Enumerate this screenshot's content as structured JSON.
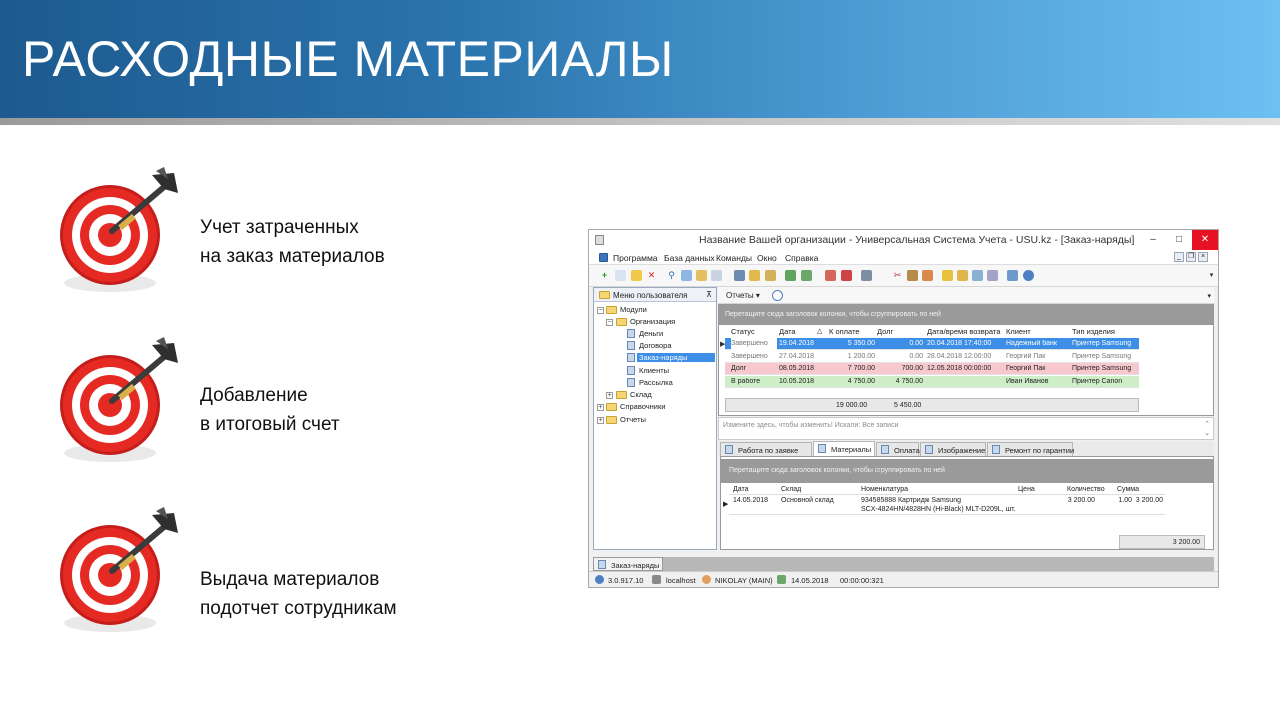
{
  "slide": {
    "title": "РАСХОДНЫЕ МАТЕРИАЛЫ"
  },
  "bullets": [
    {
      "icon": "dart-target-icon",
      "line1": "Учет затраченных",
      "line2": "на заказ материалов"
    },
    {
      "icon": "dart-target-icon",
      "line1": "Добавление",
      "line2": "в итоговый счет"
    },
    {
      "icon": "dart-target-icon",
      "line1": "Выдача материалов",
      "line2": "подотчет сотрудникам"
    }
  ],
  "window": {
    "title": "Название Вашей организации - Универсальная Система Учета - USU.kz - [Заказ-наряды]",
    "controls": {
      "minimize": "–",
      "maximize": "□",
      "close": "✕"
    },
    "mdi_controls": {
      "minimize": "_",
      "restore": "❐",
      "close": "×"
    },
    "menu": [
      "Программа",
      "База данных",
      "Команды",
      "Окно",
      "Справка"
    ],
    "tree": {
      "header": "Меню пользователя",
      "nodes": [
        {
          "label": "Модули"
        },
        {
          "label": "Организация"
        },
        {
          "label": "Деньги"
        },
        {
          "label": "Договора"
        },
        {
          "label": "Заказ-наряды"
        },
        {
          "label": "Клиенты"
        },
        {
          "label": "Рассылка"
        },
        {
          "label": "Склад"
        },
        {
          "label": "Справочники"
        },
        {
          "label": "Отчеты"
        }
      ]
    },
    "reports_label": "Отчеты",
    "group_hint": "Перетащите сюда заголовок колонки, чтобы сгруппировать по ней",
    "orders": {
      "columns": [
        "Статус",
        "Дата",
        "К оплате",
        "Долг",
        "Дата/время возврата",
        "Клиент",
        "Тип изделия"
      ],
      "rows": [
        {
          "status": "Завершено",
          "date": "19.04.2018",
          "to_pay": "5 350.00",
          "debt": "0.00",
          "return": "20.04.2018 17:40:00",
          "client": "Надежный банк",
          "product": "Принтер Samsung",
          "bg": "#3d8ee6",
          "fg": "#ffffff"
        },
        {
          "status": "Завершено",
          "date": "27.04.2018",
          "to_pay": "1 200.00",
          "debt": "0.00",
          "return": "28.04.2018 12:00:00",
          "client": "Георгий Пак",
          "product": "Принтер Samsung",
          "bg": "#ffffff",
          "fg": "#777777"
        },
        {
          "status": "Долг",
          "date": "08.05.2018",
          "to_pay": "7 700.00",
          "debt": "700.00",
          "return": "12.05.2018 00:00:00",
          "client": "Георгий Пак",
          "product": "Принтер Samsung",
          "bg": "#f7c9cf",
          "fg": "#222222"
        },
        {
          "status": "В работе",
          "date": "10.05.2018",
          "to_pay": "4 750.00",
          "debt": "4 750.00",
          "return": "",
          "client": "Иван Иванов",
          "product": "Принтер Canon",
          "bg": "#cdeec7",
          "fg": "#222222"
        }
      ],
      "totals": {
        "to_pay": "19 000.00",
        "debt": "5 450.00"
      }
    },
    "filter_hint": "Измените здесь, чтобы изменить! Искали: Все записи",
    "tabs": [
      "Работа по заявке",
      "Материалы",
      "Оплата",
      "Изображение",
      "Ремонт по гарантии"
    ],
    "active_tab": "Материалы",
    "materials": {
      "columns": [
        "Дата",
        "Склад",
        "Номенклатура",
        "Цена",
        "Количество",
        "Сумма"
      ],
      "row": {
        "date": "14.05.2018",
        "warehouse": "Основной склад",
        "item_line1": "934585888 Картридж Samsung",
        "item_line2": "SCX-4824HN/4828HN (Hi-Black) MLT-D209L, шт.",
        "price": "3 200.00",
        "qty": "1.00",
        "sum": "3 200.00"
      },
      "total": "3 200.00"
    },
    "doc_tab": "Заказ-наряды",
    "status": {
      "version": "3.0.917.10",
      "server": "localhost",
      "user": "NIKOLAY (MAIN)",
      "date": "14.05.2018",
      "timer": "00:00:00:321"
    }
  },
  "colors": {
    "header_dark": "#1d5a8e",
    "header_light": "#6cc0f2",
    "target_red": "#d9221f",
    "selection_blue": "#3d8ee6",
    "debt_pink": "#f7c9cf",
    "in_work_green": "#cdeec7"
  }
}
